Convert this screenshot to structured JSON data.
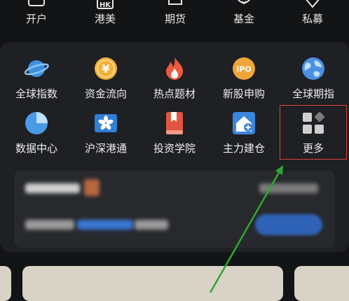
{
  "top_nav": [
    {
      "key": "open-account",
      "label": "开户"
    },
    {
      "key": "hk-us",
      "label": "港美",
      "badge": "HK"
    },
    {
      "key": "futures",
      "label": "期货"
    },
    {
      "key": "fund",
      "label": "基金"
    },
    {
      "key": "private-fund",
      "label": "私募"
    }
  ],
  "grid_items": [
    {
      "key": "global-index",
      "label": "全球指数",
      "icon": "planet-icon",
      "color": "#3f8fe0"
    },
    {
      "key": "capital-flow",
      "label": "资金流向",
      "icon": "yen-coin-icon",
      "color": "#f0b23a"
    },
    {
      "key": "hot-topics",
      "label": "热点题材",
      "icon": "flame-icon",
      "color": "#ea5a3c"
    },
    {
      "key": "ipo-subscribe",
      "label": "新股申购",
      "icon": "ipo-badge-icon",
      "color": "#f0a53a",
      "badge": "IPO"
    },
    {
      "key": "global-futures",
      "label": "全球期指",
      "icon": "globe-icon",
      "color": "#4a90e2"
    },
    {
      "key": "data-center",
      "label": "数据中心",
      "icon": "pie-chart-icon",
      "color": "#4a9be6"
    },
    {
      "key": "sh-sz-hk-connect",
      "label": "沪深港通",
      "icon": "bauhinia-flag-icon",
      "color": "#2f7fd6"
    },
    {
      "key": "investment-academy",
      "label": "投资学院",
      "icon": "bookmark-book-icon",
      "color": "#e2553f"
    },
    {
      "key": "main-force",
      "label": "主力建仓",
      "icon": "house-plus-icon",
      "color": "#3b86dc"
    },
    {
      "key": "more",
      "label": "更多",
      "icon": "four-squares-icon",
      "color": "#9a9a9a"
    }
  ],
  "colors": {
    "highlight_border": "#d9443f",
    "arrow": "#2ea832",
    "panel_bg": "#1e2023"
  }
}
